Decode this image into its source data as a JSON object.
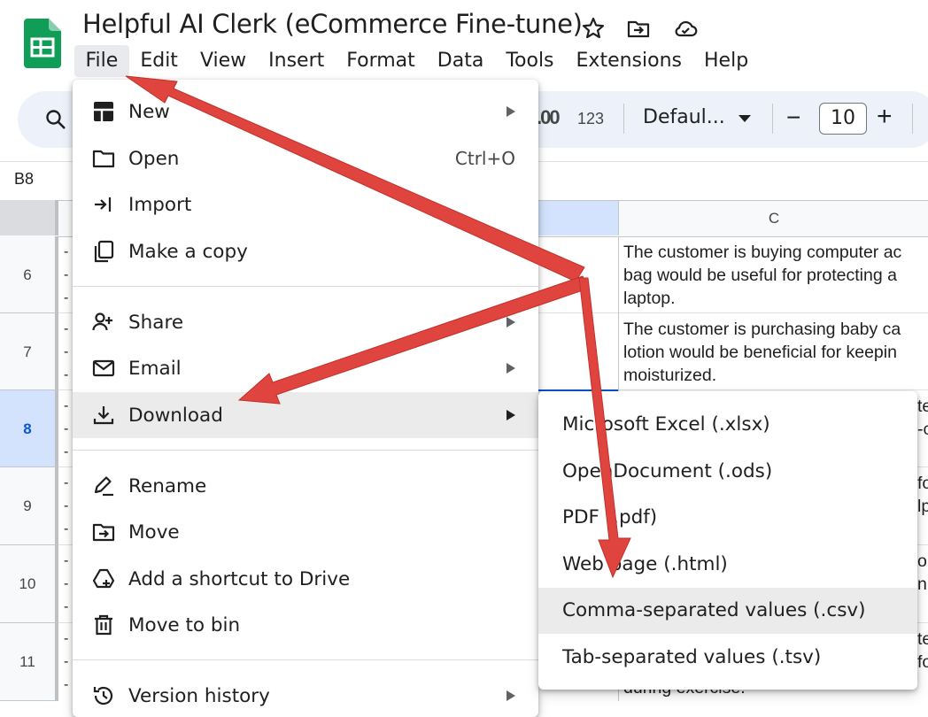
{
  "app": {
    "title": "Helpful AI Clerk (eCommerce Fine-tune)",
    "icons": [
      "sheets-logo-icon",
      "star-icon",
      "move-folder-icon",
      "cloud-saved-icon"
    ]
  },
  "menubar": [
    "File",
    "Edit",
    "View",
    "Insert",
    "Format",
    "Data",
    "Tools",
    "Extensions",
    "Help"
  ],
  "toolbar": {
    "number_format": "123",
    "font": "Defaul...",
    "font_size": "10",
    "minus": "−",
    "plus": "+",
    "decimal_label": ".00"
  },
  "name_box": "B8",
  "grid": {
    "column_c_header": "C",
    "rows": [
      {
        "num": "6",
        "c_lines": [
          "The customer is buying computer ac",
          "bag would be useful for protecting a",
          "laptop."
        ]
      },
      {
        "num": "7",
        "c_lines": [
          "The customer is purchasing baby ca",
          "lotion would be beneficial for keepin",
          "moisturized."
        ]
      },
      {
        "num": "8",
        "c_lines": [
          "te",
          "-c"
        ]
      },
      {
        "num": "9",
        "c_lines": [
          "fo",
          "lp"
        ]
      },
      {
        "num": "10",
        "c_lines": [
          "ori",
          "n"
        ]
      },
      {
        "num": "11",
        "c_lines": [
          "te",
          "fo"
        ]
      }
    ],
    "row11_bottom_text": "during exercise."
  },
  "file_menu": {
    "items": [
      {
        "label": "New",
        "icon": "new-sheet-icon",
        "submenu": true
      },
      {
        "label": "Open",
        "icon": "folder-open-icon",
        "shortcut": "Ctrl+O"
      },
      {
        "label": "Import",
        "icon": "import-icon"
      },
      {
        "label": "Make a copy",
        "icon": "copy-icon"
      },
      {
        "label": "Share",
        "icon": "share-person-icon",
        "submenu": true
      },
      {
        "label": "Email",
        "icon": "email-icon",
        "submenu": true
      },
      {
        "label": "Download",
        "icon": "download-icon",
        "submenu": true,
        "highlighted": true
      },
      {
        "label": "Rename",
        "icon": "rename-icon"
      },
      {
        "label": "Move",
        "icon": "move-icon"
      },
      {
        "label": "Add a shortcut to Drive",
        "icon": "drive-shortcut-icon"
      },
      {
        "label": "Move to bin",
        "icon": "trash-icon"
      },
      {
        "label": "Version history",
        "icon": "history-icon",
        "submenu": true
      }
    ]
  },
  "download_menu": {
    "items": [
      "Microsoft Excel (.xlsx)",
      "OpenDocument (.ods)",
      "PDF (.pdf)",
      "Web page (.html)",
      "Comma-separated values (.csv)",
      "Tab-separated values (.tsv)"
    ],
    "highlighted_index": 4
  },
  "annotation": {
    "arrow_color": "#e0443e"
  }
}
